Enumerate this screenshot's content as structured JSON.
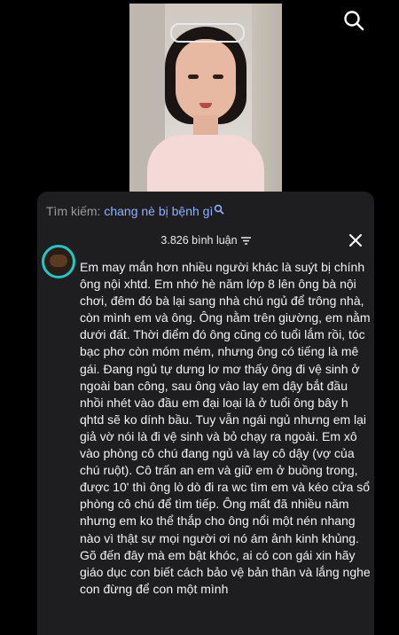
{
  "search": {
    "prefix": "Tìm kiếm:",
    "query": "chang nè bị bệnh gì"
  },
  "comments_header": {
    "count_label": "3.826 bình luận"
  },
  "comment": {
    "text": "Em may mắn hơn nhiều người khác là suýt bị chính ông nội xhtd. Em nhớ hè năm lớp 8 lên ông bà nội chơi, đêm đó bà lại sang nhà chú ngủ để trông nhà, còn mình em và ông. Ông nằm trên giường, em nằm dưới đất. Thời điểm đó ông cũng có tuổi lắm rồi, tóc bạc phơ còn móm mém, nhưng ông có tiếng là mê gái. Đang ngủ tự dưng lơ mơ thấy ông đi vệ sinh ở ngoài ban công, sau ông vào lay em dậy bắt đầu nhồi nhét vào đầu em đại loại là ở tuổi ông bây h qhtd sẽ ko dính bầu. Tuy vẫn ngái ngủ nhưng em lại giả vờ nói là đi vệ sinh và bỏ chạy ra ngoài. Em xô vào phòng cô chú đang ngủ và lay cô dậy (vợ của chú ruột). Cô trấn an em và giữ em ở buồng trong, được 10' thì ông lò dò đi ra wc tìm em và kéo cửa sổ phòng cô chú để tìm tiếp. Ông mất đã nhiều năm nhưng em ko thể thắp cho ông nổi một nén nhang nào vì thật sự mọi người ơi nó ám ảnh kinh khủng. Gõ đến đây mà em bật khóc, ai có con gái xin hãy giáo dục con biết cách bảo vệ bản thân và lắng nghe con đừng để con một mình"
  },
  "icons": {
    "search": "search-icon",
    "close": "close-icon",
    "sort": "sort-icon",
    "magnifier": "magnifier-icon"
  },
  "colors": {
    "background": "#000000",
    "panel": "#1e1e20",
    "link": "#8fb0ff",
    "avatar_ring": "#20c8c8",
    "muted": "#9a9aa0"
  }
}
